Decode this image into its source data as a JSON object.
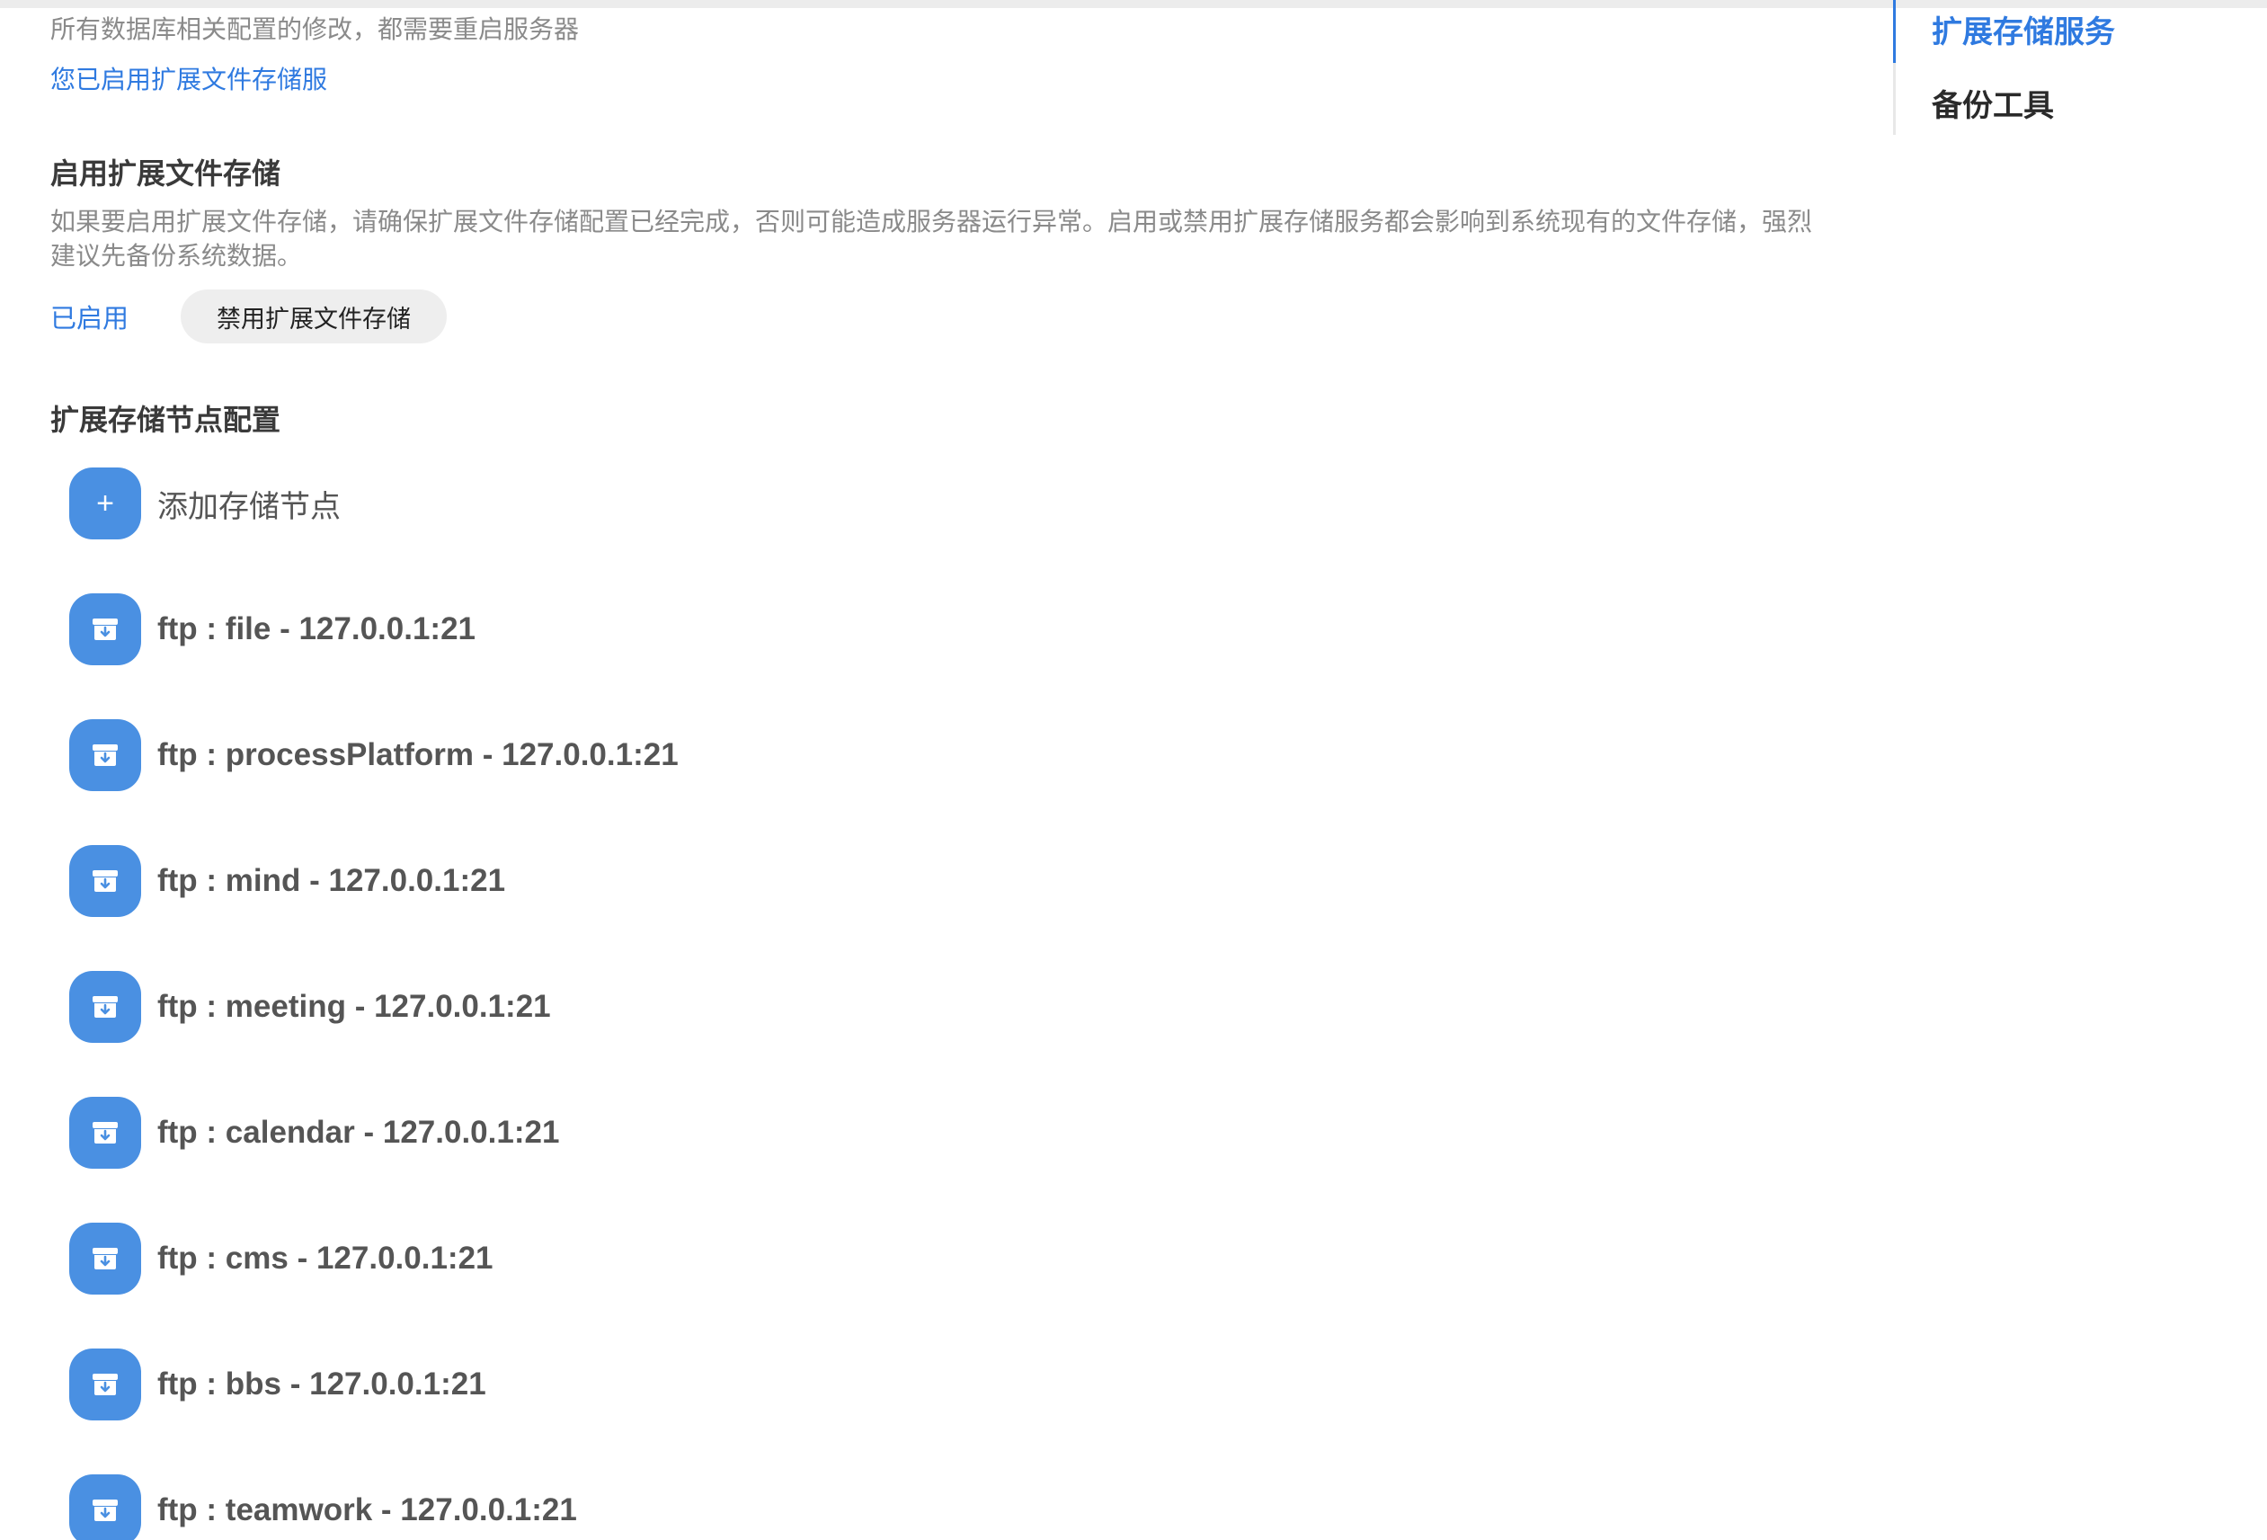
{
  "header": {
    "restart_notice": "所有数据库相关配置的修改，都需要重启服务器",
    "enabled_link": "您已启用扩展文件存储服"
  },
  "enable_section": {
    "title": "启用扩展文件存储",
    "description": "如果要启用扩展文件存储，请确保扩展文件存储配置已经完成，否则可能造成服务器运行异常。启用或禁用扩展存储服务都会影响到系统现有的文件存储，强烈建议先备份系统数据。",
    "status": "已启用",
    "disable_button": "禁用扩展文件存储"
  },
  "nodes_section": {
    "title": "扩展存储节点配置",
    "add_label": "添加存储节点",
    "add_icon": "plus-icon",
    "node_icon": "storage-box-icon",
    "nodes": [
      "ftp : file - 127.0.0.1:21",
      "ftp : processPlatform - 127.0.0.1:21",
      "ftp : mind - 127.0.0.1:21",
      "ftp : meeting - 127.0.0.1:21",
      "ftp : calendar - 127.0.0.1:21",
      "ftp : cms - 127.0.0.1:21",
      "ftp : bbs - 127.0.0.1:21",
      "ftp : teamwork - 127.0.0.1:21"
    ]
  },
  "side_nav": {
    "items": [
      {
        "label": "扩展存储服务",
        "active": true
      },
      {
        "label": "备份工具",
        "active": false
      }
    ]
  },
  "colors": {
    "accent": "#2f7ae0",
    "icon_bg": "#4a90e2",
    "muted_text": "#8a8a8a"
  }
}
